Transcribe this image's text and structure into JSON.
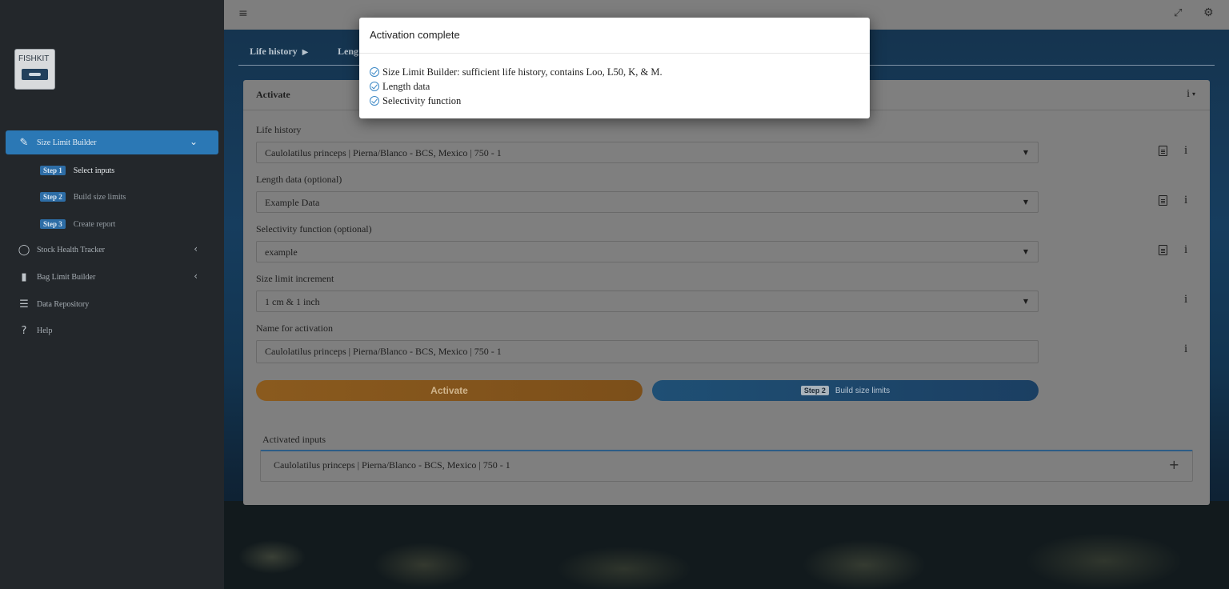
{
  "sidebar": {
    "logo_text": "FISHKIT",
    "items": [
      {
        "label": "Size Limit Builder",
        "icon": "ruler-icon"
      },
      {
        "label": "Stock Health Tracker",
        "icon": "spinner-icon"
      },
      {
        "label": "Bag Limit Builder",
        "icon": "bar-chart-icon"
      },
      {
        "label": "Data Repository",
        "icon": "database-icon"
      },
      {
        "label": "Help",
        "icon": "question-icon"
      }
    ],
    "steps": [
      {
        "badge": "Step 1",
        "label": "Select inputs"
      },
      {
        "badge": "Step 2",
        "label": "Build size limits"
      },
      {
        "badge": "Step 3",
        "label": "Create report"
      }
    ],
    "glyphs": {
      "ruler": "✎",
      "spinner": "◯",
      "bars": "▮",
      "db": "☰",
      "help": "?",
      "chev_down": "⌄",
      "chev_left": "‹"
    }
  },
  "topbar": {
    "menu_glyph": "≡",
    "expand_glyph": "⤢",
    "gear_glyph": "⚙"
  },
  "tabs": [
    {
      "label": "Life history",
      "marker": "▶"
    },
    {
      "label": "Leng"
    }
  ],
  "card": {
    "title": "Activate",
    "info": "i",
    "caret": "▾",
    "fields": [
      {
        "label": "Life history",
        "value": "Caulolatilus princeps | Pierna/Blanco - BCS, Mexico | 750 - 1"
      },
      {
        "label": "Length data (optional)",
        "value": "Example Data"
      },
      {
        "label": "Selectivity function (optional)",
        "value": "example"
      },
      {
        "label": "Size limit increment",
        "value": "1 cm & 1 inch"
      },
      {
        "label": "Name for activation",
        "value": "Caulolatilus princeps | Pierna/Blanco - BCS, Mexico | 750 - 1"
      }
    ],
    "select_arrow": "▼",
    "info_glyph": "i",
    "activate_button": "Activate",
    "step2_badge": "Step 2",
    "step2_label": "Build size limits",
    "activated_label": "Activated inputs",
    "activated_item": "Caulolatilus princeps | Pierna/Blanco - BCS, Mexico | 750 - 1",
    "plus": "+"
  },
  "modal": {
    "title": "Activation complete",
    "items": [
      "Size Limit Builder: sufficient life history, contains Loo, L50, K, & M.",
      "Length data",
      "Selectivity function"
    ]
  }
}
